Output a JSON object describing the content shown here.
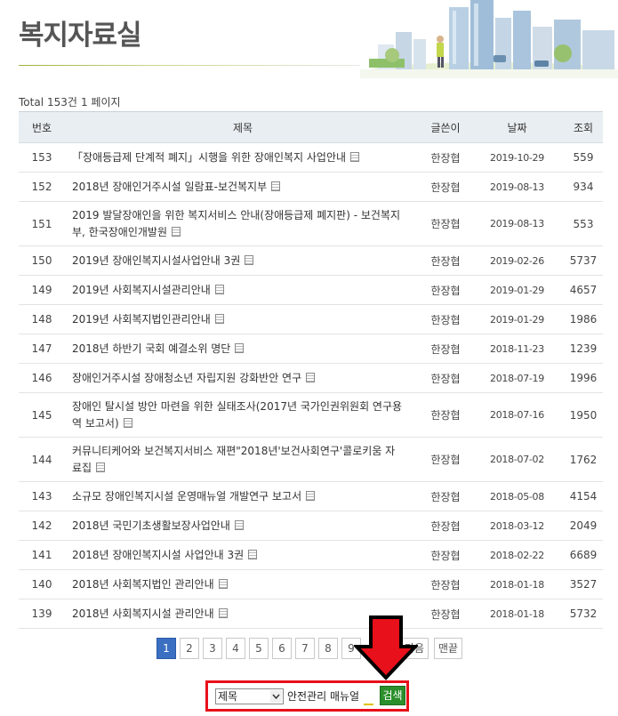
{
  "page": {
    "title": "복지자료실",
    "total_label": "Total",
    "total_count": "153건",
    "page_info": "1 페이지"
  },
  "table": {
    "headers": [
      "번호",
      "제목",
      "글쓴이",
      "날짜",
      "조회"
    ],
    "rows": [
      {
        "no": "153",
        "title": "「장애등급제 단계적 폐지」시행을 위한 장애인복지 사업안내",
        "author": "한장협",
        "date": "2019-10-29",
        "views": "559"
      },
      {
        "no": "152",
        "title": "2018년 장애인거주시설 일람표-보건복지부",
        "author": "한장협",
        "date": "2019-08-13",
        "views": "934"
      },
      {
        "no": "151",
        "title": "2019 발달장애인을 위한 복지서비스 안내(장애등급제 폐지판) - 보건복지부, 한국장애인개발원",
        "author": "한장협",
        "date": "2019-08-13",
        "views": "553"
      },
      {
        "no": "150",
        "title": "2019년 장애인복지시설사업안내 3권",
        "author": "한장협",
        "date": "2019-02-26",
        "views": "5737"
      },
      {
        "no": "149",
        "title": "2019년 사회복지시설관리안내",
        "author": "한장협",
        "date": "2019-01-29",
        "views": "4657"
      },
      {
        "no": "148",
        "title": "2019년 사회복지법인관리안내",
        "author": "한장협",
        "date": "2019-01-29",
        "views": "1986"
      },
      {
        "no": "147",
        "title": "2018년 하반기 국회 예결소위 명단",
        "author": "한장협",
        "date": "2018-11-23",
        "views": "1239"
      },
      {
        "no": "146",
        "title": "장애인거주시설 장애청소년 자립지원 강화반안 연구",
        "author": "한장협",
        "date": "2018-07-19",
        "views": "1996"
      },
      {
        "no": "145",
        "title": "장애인 탈시설 방안 마련을 위한 실태조사(2017년 국가인권위원회 연구용역 보고서)",
        "author": "한장협",
        "date": "2018-07-16",
        "views": "1950"
      },
      {
        "no": "144",
        "title": "커뮤니티케어와 보건복지서비스 재편\"2018년'보건사회연구'콜로키움 자료집",
        "author": "한장협",
        "date": "2018-07-02",
        "views": "1762"
      },
      {
        "no": "143",
        "title": "소규모 장애인복지시설 운영매뉴얼 개발연구 보고서",
        "author": "한장협",
        "date": "2018-05-08",
        "views": "4154"
      },
      {
        "no": "142",
        "title": "2018년 국민기초생활보장사업안내",
        "author": "한장협",
        "date": "2018-03-12",
        "views": "2049"
      },
      {
        "no": "141",
        "title": "2018년 장애인복지시설 사업안내 3권",
        "author": "한장협",
        "date": "2018-02-22",
        "views": "6689"
      },
      {
        "no": "140",
        "title": "2018년 사회복지법인 관리안내",
        "author": "한장협",
        "date": "2018-01-18",
        "views": "3527"
      },
      {
        "no": "139",
        "title": "2018년 사회복지시설 관리안내",
        "author": "한장협",
        "date": "2018-01-18",
        "views": "5732"
      }
    ]
  },
  "pagination": {
    "pages": [
      "1",
      "2",
      "3",
      "4",
      "5",
      "6",
      "7",
      "8",
      "9"
    ],
    "current": "1",
    "next_label": "다음",
    "last_label": "맨끝"
  },
  "search": {
    "field_selected": "제목",
    "query": "안전관리 매뉴얼",
    "button_label": "검색"
  },
  "icons": {
    "attachment": "file-icon",
    "annotation": "red-arrow-down-icon"
  },
  "colors": {
    "header_bg": "#e9eef2",
    "active_page": "#3b6fc1",
    "search_button": "#2b8f2b",
    "highlight": "#e8101a"
  }
}
